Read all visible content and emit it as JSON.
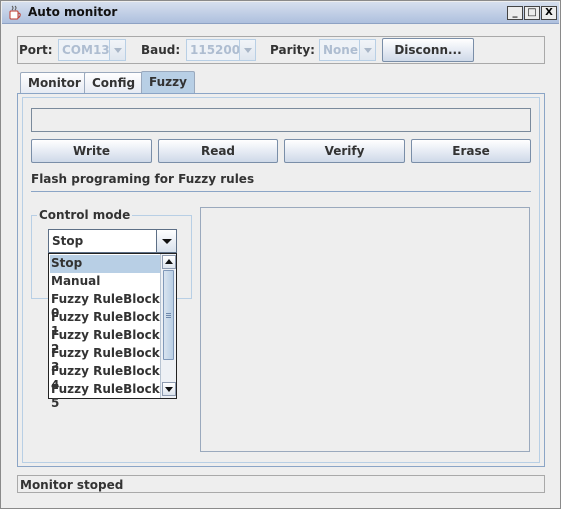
{
  "window": {
    "title": "Auto monitor",
    "controls": {
      "minimize": "_",
      "maximize": "□",
      "close": "X"
    }
  },
  "connection": {
    "port_label": "Port:",
    "port_value": "COM13",
    "baud_label": "Baud:",
    "baud_value": "115200",
    "parity_label": "Parity:",
    "parity_value": "None",
    "disconnect_label": "Disconn..."
  },
  "tabs": [
    {
      "label": "Monitor",
      "active": false
    },
    {
      "label": "Config",
      "active": false
    },
    {
      "label": "Fuzzy",
      "active": true
    }
  ],
  "fuzzy": {
    "buttons": {
      "write": "Write",
      "read": "Read",
      "verify": "Verify",
      "erase": "Erase"
    },
    "flash_label": "Flash programing for Fuzzy rules",
    "control_mode": {
      "title": "Control mode",
      "selected": "Stop",
      "options": [
        "Stop",
        "Manual",
        "Fuzzy RuleBlock 0",
        "Fuzzy RuleBlock 1",
        "Fuzzy RuleBlock 2",
        "Fuzzy RuleBlock 3",
        "Fuzzy RuleBlock 4",
        "Fuzzy RuleBlock 5"
      ],
      "highlighted_index": 0
    }
  },
  "status": {
    "text": "Monitor stoped"
  },
  "colors": {
    "accent": "#b8cfe5",
    "border": "#8ba5c6",
    "disabled_text": "#aebdd1"
  }
}
